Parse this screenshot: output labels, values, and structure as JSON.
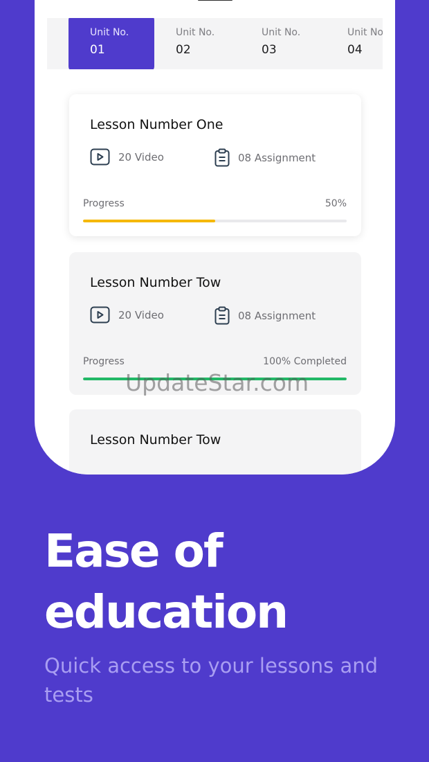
{
  "units": [
    {
      "label": "Unit No.",
      "number": "01",
      "active": true
    },
    {
      "label": "Unit No.",
      "number": "02",
      "active": false
    },
    {
      "label": "Unit No.",
      "number": "03",
      "active": false
    },
    {
      "label": "Unit No.",
      "number": "04",
      "active": false
    }
  ],
  "lessons": [
    {
      "title": "Lesson Number One",
      "videos": "20 Video",
      "assignments": "08 Assignment",
      "progress_label": "Progress",
      "progress_value": "50%",
      "progress_fraction": 0.5,
      "progress_color": "#f5b800"
    },
    {
      "title": "Lesson Number Tow",
      "videos": "20 Video",
      "assignments": "08 Assignment",
      "progress_label": "Progress",
      "progress_value": "100%  Completed",
      "progress_fraction": 1.0,
      "progress_color": "#22b866"
    },
    {
      "title": "Lesson Number Tow"
    }
  ],
  "watermark": "UpdateStar.com",
  "promo": {
    "headline_line1": "Ease of",
    "headline_line2": "education",
    "subtitle": "Quick access to your lessons and tests"
  },
  "colors": {
    "brand": "#4f3bcc",
    "accent_progress": "#f5b800",
    "complete_progress": "#22b866"
  }
}
